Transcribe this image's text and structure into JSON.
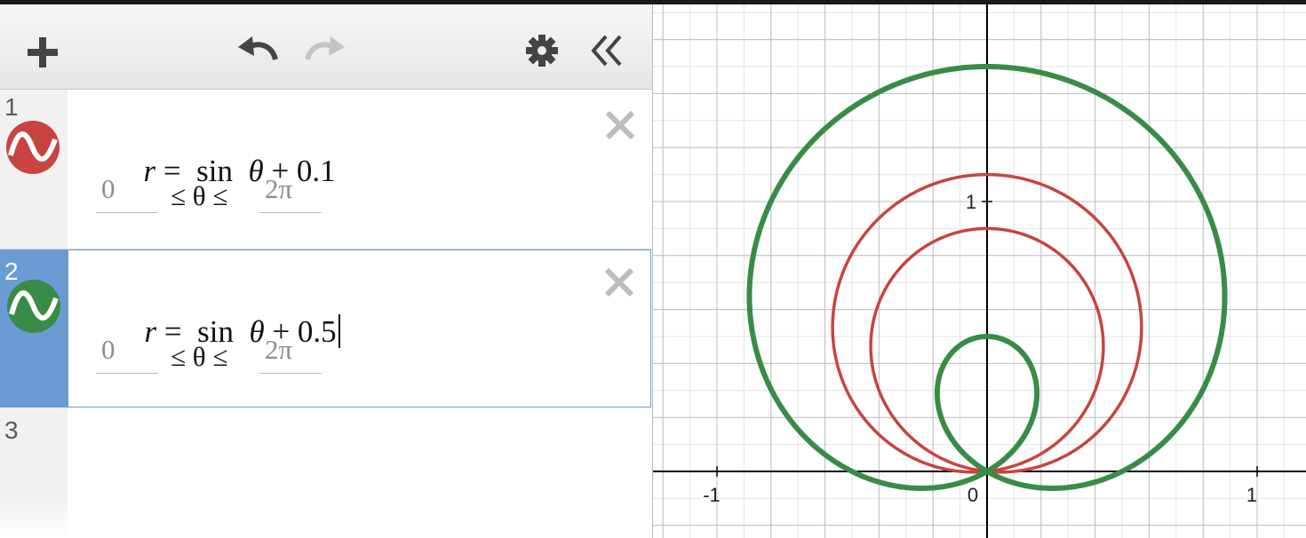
{
  "toolbar": {
    "add_icon": "plus-icon",
    "undo_icon": "undo-icon",
    "redo_icon": "redo-icon",
    "settings_icon": "gear-icon",
    "collapse_icon": "double-chevron-left-icon"
  },
  "expressions": [
    {
      "index": "1",
      "color": "#c74440",
      "lhs": "r",
      "eq": "=",
      "func": "sin",
      "var": "θ",
      "rest": "+ 0.1",
      "domain_min": "0",
      "domain_var": "≤ θ ≤",
      "domain_max": "2π",
      "selected": false
    },
    {
      "index": "2",
      "color": "#388c46",
      "lhs": "r",
      "eq": "=",
      "func": "sin",
      "var": "θ",
      "rest": "+ 0.5",
      "domain_min": "0",
      "domain_var": "≤ θ ≤",
      "domain_max": "2π",
      "selected": true
    },
    {
      "index": "3"
    }
  ],
  "graph": {
    "x_ticks": [
      "-1",
      "0",
      "1"
    ],
    "y_ticks": [
      "1"
    ],
    "xlim": [
      -1.0,
      1.2
    ],
    "ylim": [
      -0.2,
      1.65
    ],
    "colors": {
      "red": "#c74440",
      "green": "#388c46",
      "axis": "#000000",
      "grid_major": "#bfbfbf",
      "grid_minor": "#e4e4e4"
    }
  },
  "chart_data": {
    "type": "line",
    "title": "",
    "xlabel": "",
    "ylabel": "",
    "x_tick_labels": [
      "-1",
      "0",
      "1"
    ],
    "y_tick_labels": [
      "1"
    ],
    "grid": true,
    "series": [
      {
        "name": "r = sin θ + 0.1",
        "color": "#c74440",
        "polar": {
          "a": 0.1,
          "theta_range": [
            0,
            6.2832
          ]
        }
      },
      {
        "name": "r = sin θ + 0.5",
        "color": "#388c46",
        "polar": {
          "a": 0.5,
          "theta_range": [
            0,
            6.2832
          ]
        }
      }
    ]
  }
}
